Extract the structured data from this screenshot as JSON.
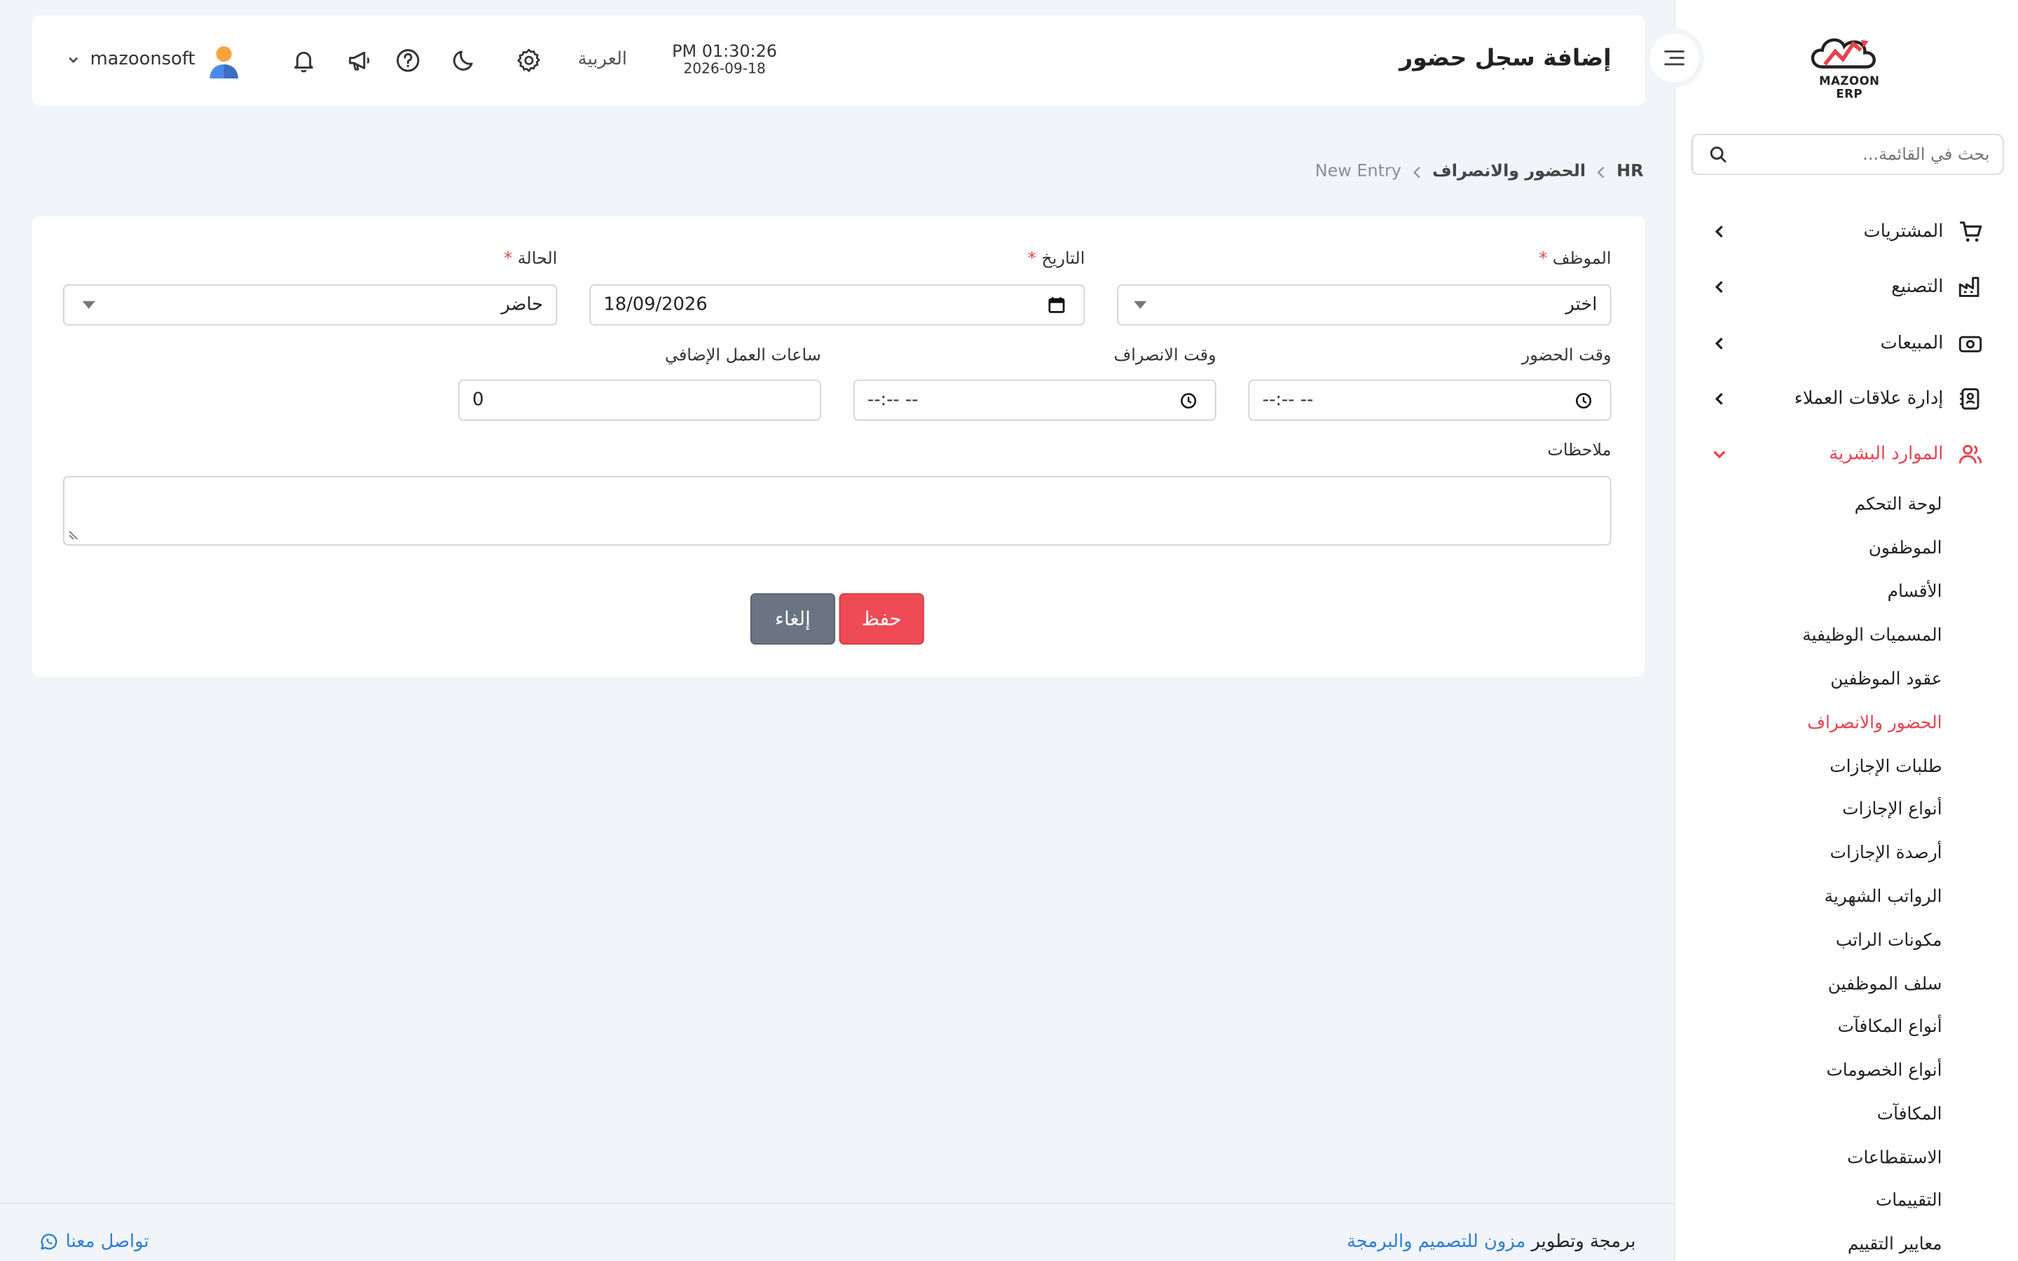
{
  "app": {
    "logo_text": "MAZOON ERP"
  },
  "sidebar": {
    "search_placeholder": "بحث في القائمة...",
    "items": [
      {
        "label": "المشتريات"
      },
      {
        "label": "التصنيع"
      },
      {
        "label": "المبيعات"
      },
      {
        "label": "إدارة علاقات العملاء"
      },
      {
        "label": "الموارد البشرية"
      }
    ],
    "hr_submenu": [
      "لوحة التحكم",
      "الموظفون",
      "الأقسام",
      "المسميات الوظيفية",
      "عقود الموظفين",
      "الحضور والانصراف",
      "طلبات الإجازات",
      "أنواع الإجازات",
      "أرصدة الإجازات",
      "الرواتب الشهرية",
      "مكونات الراتب",
      "سلف الموظفين",
      "أنواع المكافآت",
      "أنواع الخصومات",
      "المكافآت",
      "الاستقطاعات",
      "التقييمات",
      "معايير التقييم"
    ],
    "active_submenu": "الحضور والانصراف"
  },
  "header": {
    "title": "إضافة سجل حضور",
    "time": "PM 01:30:26",
    "date": "2026-09-18",
    "language": "العربية",
    "username": "mazoonsoft"
  },
  "breadcrumb": {
    "root": "HR",
    "section": "الحضور والانصراف",
    "current": "New Entry"
  },
  "form": {
    "employee": {
      "label": "الموظف",
      "value": "اختر"
    },
    "date": {
      "label": "التاريخ",
      "value": "18/09/2026"
    },
    "status": {
      "label": "الحالة",
      "value": "حاضر"
    },
    "check_in": {
      "label": "وقت الحضور",
      "value": "--:-- --"
    },
    "check_out": {
      "label": "وقت الانصراف",
      "value": "--:-- --"
    },
    "overtime": {
      "label": "ساعات العمل الإضافي",
      "value": "0"
    },
    "notes": {
      "label": "ملاحظات",
      "value": ""
    },
    "required_mark": "*",
    "save_label": "حفظ",
    "cancel_label": "إلغاء"
  },
  "footer": {
    "credit_prefix": "برمجة وتطوير",
    "credit_link": "مزون للتصميم والبرمجة",
    "contact": "تواصل معنا"
  },
  "colors": {
    "accent": "#e8424f",
    "link": "#2b7fd6",
    "background": "#f1f4f8",
    "cancel": "#6b7482"
  }
}
